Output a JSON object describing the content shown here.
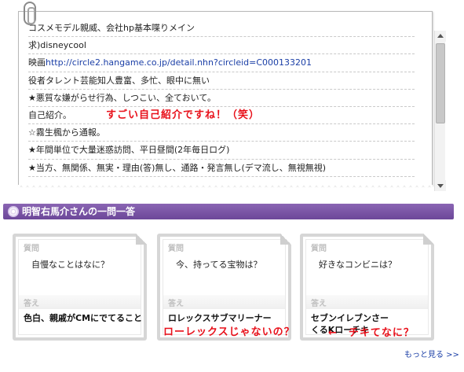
{
  "memo": {
    "lines": [
      {
        "text": "コスメモデル親威、会社hp基本喋りメイン"
      },
      {
        "text": "求)disneycool"
      },
      {
        "prefix": "映画",
        "link": "http://circle2.hangame.co.jp/detail.nhn?circleid=C000133201"
      },
      {
        "text": "役者タレント芸能知人豊富、多忙、眼中に無い"
      },
      {
        "text": "★悪質な嫌がらせ行為、しつこい、全ておいて。"
      },
      {
        "text": "自己紹介。",
        "note": "すごい自己紹介ですね！（笑）"
      },
      {
        "text": "☆霧生楓から通報。"
      },
      {
        "text": "★年間単位で大量迷惑訪問、平日昼間(2年毎日ログ)"
      },
      {
        "text": "★当方、無関係、無実・理由(答)無し、通路・発言無し(デマ流し、無視無視)"
      }
    ]
  },
  "section": {
    "title": "明智右馬介さんの一問一答"
  },
  "cards": [
    {
      "q_label": "質問",
      "question": "自慢なことはなに？",
      "a_label": "答え",
      "answer": "色白、親戚がCMにでてること"
    },
    {
      "q_label": "質問",
      "question": "今、持ってる宝物は？",
      "a_label": "答え",
      "answer": "ロレックスサブマリーナー"
    },
    {
      "q_label": "質問",
      "question": "好きなコンビニは？",
      "a_label": "答え",
      "answer": "セブンイレブンさーくるKローチキ"
    }
  ],
  "annotations": {
    "rolex_note": "ローレックスじゃないの？",
    "chicken_note": "←　チキてなに？"
  },
  "more_link": "もっと見る >>",
  "colors": {
    "section_bar": "#7a56a6",
    "link": "#1a3ea6",
    "note_red": "#e8101a"
  }
}
